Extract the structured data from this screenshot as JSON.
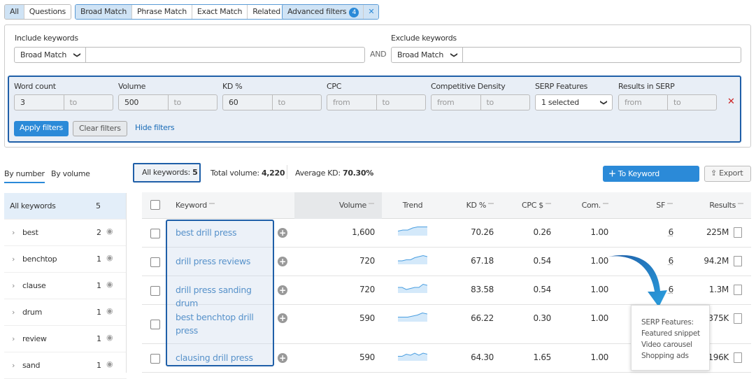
{
  "top_tabs": {
    "group1": [
      "All",
      "Questions"
    ],
    "group2": [
      "Broad Match",
      "Phrase Match",
      "Exact Match",
      "Related"
    ],
    "advanced": "Advanced filters",
    "advanced_count": "4"
  },
  "include": {
    "label": "Include keywords",
    "match": "Broad Match",
    "value": ""
  },
  "and_label": "AND",
  "exclude": {
    "label": "Exclude keywords",
    "match": "Broad Match",
    "value": ""
  },
  "filters": [
    {
      "label": "Word count",
      "from": "3",
      "to": "to"
    },
    {
      "label": "Volume",
      "from": "500",
      "to": "to"
    },
    {
      "label": "KD %",
      "from": "60",
      "to": "to"
    },
    {
      "label": "CPC",
      "from": "from",
      "to": "to"
    },
    {
      "label": "Competitive Density",
      "from": "from",
      "to": "to"
    },
    {
      "label": "SERP Features",
      "selected": "1 selected"
    },
    {
      "label": "Results in SERP",
      "from": "from",
      "to": "to"
    }
  ],
  "buttons": {
    "apply": "Apply filters",
    "clear": "Clear filters",
    "hide": "Hide filters",
    "keyword_manager": "To Keyword Manager",
    "export": "Export"
  },
  "view_tabs": [
    "By number",
    "By volume"
  ],
  "summary": {
    "all_label": "All keywords:",
    "all_value": "5",
    "vol_label": "Total volume:",
    "vol_value": "4,220",
    "kd_label": "Average KD:",
    "kd_value": "70.30%"
  },
  "sidebar": [
    {
      "label": "All keywords",
      "count": "5"
    },
    {
      "label": "best",
      "count": "2"
    },
    {
      "label": "benchtop",
      "count": "1"
    },
    {
      "label": "clause",
      "count": "1"
    },
    {
      "label": "drum",
      "count": "1"
    },
    {
      "label": "review",
      "count": "1"
    },
    {
      "label": "sand",
      "count": "1"
    }
  ],
  "columns": [
    "Keyword",
    "Volume",
    "Trend",
    "KD %",
    "CPC $",
    "Com.",
    "SF",
    "Results"
  ],
  "rows": [
    {
      "keyword": "best drill press",
      "volume": "1,600",
      "kd": "70.26",
      "cpc": "0.26",
      "com": "1.00",
      "sf": "6",
      "results": "225M",
      "trend": [
        3,
        4,
        4,
        6,
        7,
        7,
        7
      ]
    },
    {
      "keyword": "drill press reviews",
      "volume": "720",
      "kd": "67.18",
      "cpc": "0.54",
      "com": "1.00",
      "sf": "6",
      "results": "94.2M",
      "trend": [
        2,
        2,
        3,
        3,
        5,
        6,
        7,
        6
      ]
    },
    {
      "keyword": "drill press sanding drum",
      "volume": "720",
      "kd": "83.58",
      "cpc": "0.54",
      "com": "1.00",
      "sf": "6",
      "results": "1.3M",
      "trend": [
        4,
        4,
        2,
        3,
        4,
        4,
        7,
        6
      ]
    },
    {
      "keyword": "best benchtop drill press",
      "volume": "590",
      "kd": "66.22",
      "cpc": "0.30",
      "com": "1.00",
      "sf": "",
      "results": "375K",
      "trend": [
        3,
        3,
        3,
        4,
        5,
        7,
        6
      ]
    },
    {
      "keyword": "clausing drill press",
      "volume": "590",
      "kd": "64.30",
      "cpc": "1.65",
      "com": "1.00",
      "sf": "",
      "results": "196K",
      "trend": [
        3,
        3,
        5,
        4,
        6,
        4,
        6,
        5
      ]
    }
  ],
  "tooltip": {
    "title": "SERP Features:",
    "items": [
      "Featured snippet",
      "Video carousel",
      "Shopping ads"
    ]
  },
  "colors": {
    "accent": "#2b8ad8",
    "highlight_border": "#1f5fa8",
    "panel_bg": "#e8eef6",
    "link": "#1a6cb8",
    "remove": "#cc2222"
  }
}
